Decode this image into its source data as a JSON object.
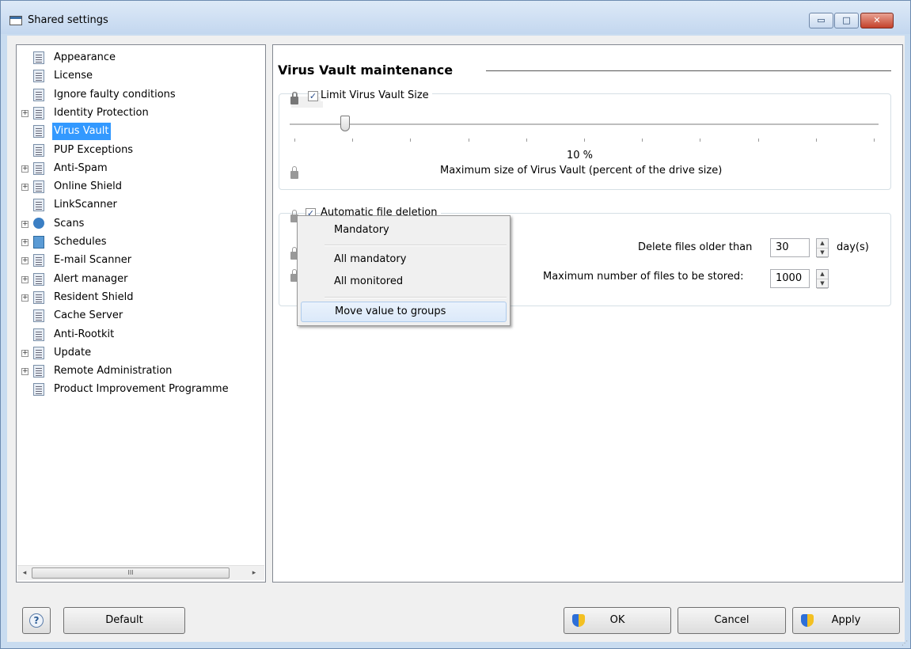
{
  "window": {
    "title": "Shared settings",
    "minimize_glyph": "▭",
    "maximize_glyph": "□",
    "close_glyph": "✕"
  },
  "tree": [
    {
      "label": "Appearance",
      "expandable": false,
      "icon": "document-icon"
    },
    {
      "label": "License",
      "expandable": false,
      "icon": "document-icon"
    },
    {
      "label": "Ignore faulty conditions",
      "expandable": false,
      "icon": "document-icon"
    },
    {
      "label": "Identity Protection",
      "expandable": true,
      "icon": "document-icon"
    },
    {
      "label": "Virus Vault",
      "expandable": false,
      "icon": "document-icon",
      "selected": true
    },
    {
      "label": "PUP Exceptions",
      "expandable": false,
      "icon": "document-icon"
    },
    {
      "label": "Anti-Spam",
      "expandable": true,
      "icon": "document-icon"
    },
    {
      "label": "Online Shield",
      "expandable": true,
      "icon": "document-icon"
    },
    {
      "label": "LinkScanner",
      "expandable": false,
      "icon": "document-icon"
    },
    {
      "label": "Scans",
      "expandable": true,
      "icon": "scan-icon"
    },
    {
      "label": "Schedules",
      "expandable": true,
      "icon": "schedule-icon"
    },
    {
      "label": "E-mail Scanner",
      "expandable": true,
      "icon": "document-icon"
    },
    {
      "label": "Alert manager",
      "expandable": true,
      "icon": "document-icon"
    },
    {
      "label": "Resident Shield",
      "expandable": true,
      "icon": "document-icon"
    },
    {
      "label": "Cache Server",
      "expandable": false,
      "icon": "document-icon"
    },
    {
      "label": "Anti-Rootkit",
      "expandable": false,
      "icon": "document-icon"
    },
    {
      "label": "Update",
      "expandable": true,
      "icon": "document-icon"
    },
    {
      "label": "Remote Administration",
      "expandable": true,
      "icon": "document-icon"
    },
    {
      "label": "Product Improvement Programme",
      "expandable": false,
      "icon": "document-icon"
    }
  ],
  "scrollbar": {
    "left_arrow": "◂",
    "right_arrow": "▸",
    "thumb_grip": "III"
  },
  "panel": {
    "title": "Virus Vault maintenance",
    "limit_group": {
      "checkbox_label": "Limit Virus Vault Size",
      "checked": true,
      "slider_value_percent": 10,
      "value_text": "10 %",
      "description": "Maximum size of Virus Vault (percent of the drive size)"
    },
    "deletion_group": {
      "checkbox_label": "Automatic file deletion",
      "checked": true,
      "older_than_label": "Delete files older than",
      "older_than_value": "30",
      "older_than_unit": "day(s)",
      "max_files_label": "Maximum number of files to be stored:",
      "max_files_value": "1000"
    }
  },
  "context_menu": {
    "items": [
      "Mandatory",
      "All mandatory",
      "All monitored",
      "Move value to groups"
    ],
    "highlighted": "Move value to groups"
  },
  "buttons": {
    "help": "?",
    "default": "Default",
    "ok": "OK",
    "cancel": "Cancel",
    "apply": "Apply"
  },
  "icons": {
    "check_mark": "✓",
    "spin_up": "▲",
    "spin_down": "▼",
    "expander_plus": "+",
    "resize_grip": "⋰"
  }
}
